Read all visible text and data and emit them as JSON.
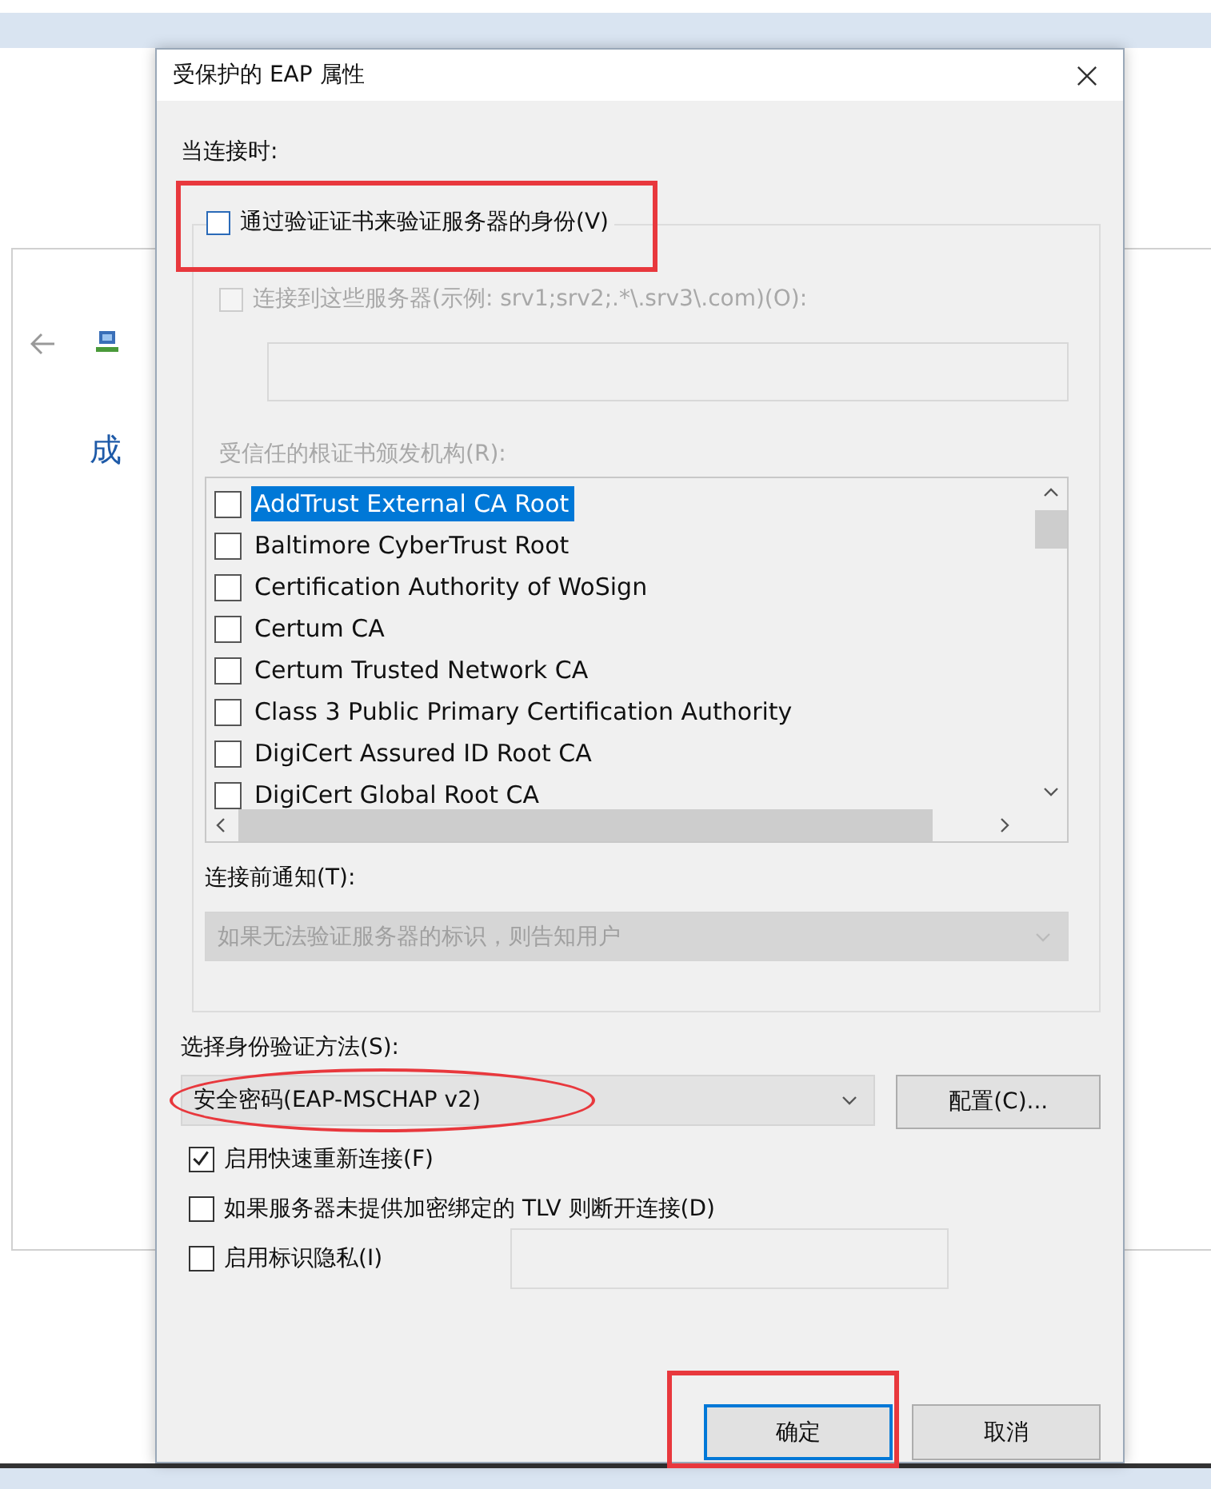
{
  "background_window": {
    "heading": "成"
  },
  "dialog": {
    "title": "受保护的 EAP 属性",
    "when_connecting_label": "当连接时:",
    "verify_server": {
      "label": "通过验证证书来验证服务器的身份(V)",
      "checked": false
    },
    "connect_to_servers": {
      "label": "连接到这些服务器(示例: srv1;srv2;.*\\.srv3\\.com)(O):",
      "checked": false,
      "disabled": true
    },
    "trusted_ca_label": {
      "text": "受信任的根证书颁发机构(R):",
      "disabled": true
    },
    "ca_list": [
      {
        "name": "AddTrust External CA Root",
        "checked": false,
        "selected": true
      },
      {
        "name": "Baltimore CyberTrust Root",
        "checked": false,
        "selected": false
      },
      {
        "name": "Certification Authority of WoSign",
        "checked": false,
        "selected": false
      },
      {
        "name": "Certum CA",
        "checked": false,
        "selected": false
      },
      {
        "name": "Certum Trusted Network CA",
        "checked": false,
        "selected": false
      },
      {
        "name": "Class 3 Public Primary Certification Authority",
        "checked": false,
        "selected": false
      },
      {
        "name": "DigiCert Assured ID Root CA",
        "checked": false,
        "selected": false
      },
      {
        "name": "DigiCert Global Root CA",
        "checked": false,
        "selected": false
      }
    ],
    "notify_label": "连接前通知(T):",
    "notify_select": {
      "value": "如果无法验证服务器的标识，则告知用户",
      "disabled": true
    },
    "method_label": "选择身份验证方法(S):",
    "method_select": {
      "value": "安全密码(EAP-MSCHAP v2)"
    },
    "configure_button": "配置(C)...",
    "options": [
      {
        "label": "启用快速重新连接(F)",
        "checked": true
      },
      {
        "label": "如果服务器未提供加密绑定的 TLV 则断开连接(D)",
        "checked": false
      },
      {
        "label": "启用标识隐私(I)",
        "checked": false
      }
    ],
    "buttons": [
      {
        "label": "确定",
        "default": true
      },
      {
        "label": "取消",
        "default": false
      }
    ]
  }
}
